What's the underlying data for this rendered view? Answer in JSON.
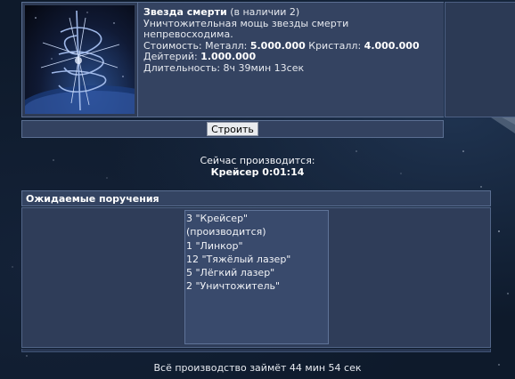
{
  "ship": {
    "name": "Звезда смерти",
    "available": "(в наличии 2)",
    "description": "Уничтожительная мощь звезды смерти непревосходима.",
    "cost_label": "Стоимость:",
    "metal_label": "Металл:",
    "metal_value": "5.000.000",
    "crystal_label": "Кристалл:",
    "crystal_value": "4.000.000",
    "deuterium_label": "Дейтерий:",
    "deuterium_value": "1.000.000",
    "duration_label": "Длительность:",
    "duration_value": "8ч 39мин 13сек"
  },
  "build_button": "Строить",
  "current": {
    "label": "Сейчас производится:",
    "item": "Крейсер 0:01:14"
  },
  "queue": {
    "title": "Ожидаемые поручения",
    "items": [
      "3 \"Крейсер\" (производится)",
      "1 \"Линкор\"",
      "12 \"Тяжёлый лазер\"",
      "5 \"Лёгкий лазер\"",
      "2 \"Уничтожитель\""
    ]
  },
  "total": "Всё производство займёт 44 мин 54 сек"
}
